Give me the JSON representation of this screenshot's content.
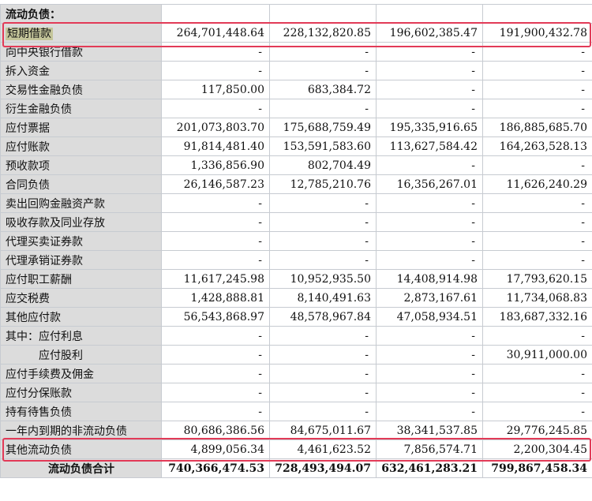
{
  "section_title": "流动负债：",
  "highlight_color": "#e23a57",
  "label_bg": "#dcdcdc",
  "rows": [
    {
      "label": "短期借款",
      "values": [
        "264,701,448.64",
        "228,132,820.85",
        "196,602,385.47",
        "191,900,432.78"
      ],
      "highlight": true
    },
    {
      "label": "向中央银行借款",
      "values": [
        "-",
        "-",
        "-",
        "-"
      ]
    },
    {
      "label": "拆入资金",
      "values": [
        "-",
        "-",
        "-",
        "-"
      ]
    },
    {
      "label": "交易性金融负债",
      "values": [
        "117,850.00",
        "683,384.72",
        "-",
        "-"
      ]
    },
    {
      "label": "衍生金融负债",
      "values": [
        "-",
        "-",
        "-",
        "-"
      ]
    },
    {
      "label": "应付票据",
      "values": [
        "201,073,803.70",
        "175,688,759.49",
        "195,335,916.65",
        "186,885,685.70"
      ]
    },
    {
      "label": "应付账款",
      "values": [
        "91,814,481.40",
        "153,591,583.60",
        "113,627,584.42",
        "164,263,528.13"
      ]
    },
    {
      "label": "预收款项",
      "values": [
        "1,336,856.90",
        "802,704.49",
        "-",
        "-"
      ]
    },
    {
      "label": "合同负债",
      "values": [
        "26,146,587.23",
        "12,785,210.76",
        "16,356,267.01",
        "11,626,240.29"
      ]
    },
    {
      "label": "卖出回购金融资产款",
      "values": [
        "-",
        "-",
        "-",
        "-"
      ]
    },
    {
      "label": "吸收存款及同业存放",
      "values": [
        "-",
        "-",
        "-",
        "-"
      ]
    },
    {
      "label": "代理买卖证券款",
      "values": [
        "-",
        "-",
        "-",
        "-"
      ]
    },
    {
      "label": "代理承销证券款",
      "values": [
        "-",
        "-",
        "-",
        "-"
      ]
    },
    {
      "label": "应付职工薪酬",
      "values": [
        "11,617,245.98",
        "10,952,935.50",
        "14,408,914.98",
        "17,793,620.15"
      ]
    },
    {
      "label": "应交税费",
      "values": [
        "1,428,888.81",
        "8,140,491.63",
        "2,873,167.61",
        "11,734,068.83"
      ]
    },
    {
      "label": "其他应付款",
      "values": [
        "56,543,868.97",
        "48,578,967.84",
        "47,058,934.51",
        "183,687,332.16"
      ]
    },
    {
      "label": "其中：应付利息",
      "values": [
        "-",
        "-",
        "-",
        "-"
      ]
    },
    {
      "label": "应付股利",
      "values": [
        "-",
        "-",
        "-",
        "30,911,000.00"
      ],
      "indent": 2
    },
    {
      "label": "应付手续费及佣金",
      "values": [
        "-",
        "-",
        "-",
        "-"
      ]
    },
    {
      "label": "应付分保账款",
      "values": [
        "-",
        "-",
        "-",
        "-"
      ]
    },
    {
      "label": "持有待售负债",
      "values": [
        "-",
        "-",
        "-",
        "-"
      ]
    },
    {
      "label": "一年内到期的非流动负债",
      "values": [
        "80,686,386.56",
        "84,675,011.67",
        "38,341,537.85",
        "29,776,245.85"
      ],
      "boxed": true
    },
    {
      "label": "其他流动负债",
      "values": [
        "4,899,056.34",
        "4,461,623.52",
        "7,856,574.71",
        "2,200,304.45"
      ]
    },
    {
      "label": "流动负债合计",
      "values": [
        "740,366,474.53",
        "728,493,494.07",
        "632,461,283.21",
        "799,867,458.34"
      ],
      "total": true
    }
  ]
}
